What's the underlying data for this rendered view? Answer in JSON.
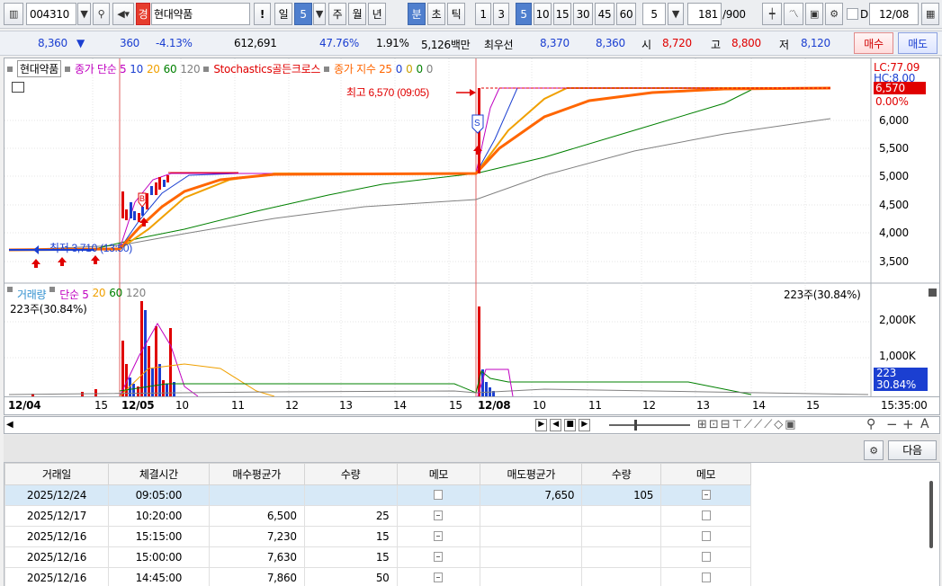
{
  "toolbar": {
    "code": "004310",
    "tag": "경",
    "name": "현대약품",
    "exclaim": "!",
    "periods": [
      "일",
      "5",
      "주",
      "월",
      "년",
      "분",
      "초",
      "틱"
    ],
    "selected_period": "분",
    "minutes": [
      "1",
      "3",
      "5",
      "10",
      "15",
      "30",
      "45",
      "60"
    ],
    "selected_minute": "5",
    "interval_value": "5",
    "count": "181",
    "count_total": "/900",
    "d_label": "D",
    "date": "12/08"
  },
  "quote": {
    "price": "8,360",
    "change_arrow": "▼",
    "change": "360",
    "change_pct": "-4.13%",
    "volume": "612,691",
    "vol_ratio": "47.76%",
    "turnover": "1.91%",
    "amount": "5,126백만",
    "best_label": "최우선",
    "best_ask": "8,370",
    "best_bid": "8,360",
    "open_label": "시",
    "open": "8,720",
    "high_label": "고",
    "high": "8,800",
    "low_label": "저",
    "low": "8,120",
    "buy_button": "매수",
    "sell_button": "매도"
  },
  "price_panel": {
    "legend": [
      {
        "text": "현대약품",
        "color": "#000000",
        "boxed": true
      },
      {
        "text": "종가 단순 5",
        "color": "#c000c0"
      },
      {
        "text": "10",
        "color": "#1b3fd1"
      },
      {
        "text": "20",
        "color": "#f0a000"
      },
      {
        "text": "60",
        "color": "#008000"
      },
      {
        "text": "120",
        "color": "#808080"
      },
      {
        "text": "Stochastics골든크로스",
        "color": "#e00000"
      },
      {
        "text": "종가 지수 25",
        "color": "#ff6600"
      },
      {
        "text": "0",
        "color": "#1b3fd1"
      },
      {
        "text": "0",
        "color": "#c8a000"
      },
      {
        "text": "0",
        "color": "#008000"
      },
      {
        "text": "0",
        "color": "#808080"
      }
    ],
    "high_annotation": "최고 6,570 (09:05)",
    "low_annotation": "최저 3,710 (13:50)",
    "lc_label": "LC:77.09",
    "hc_label": "HC:8.00",
    "current_price": "6,570",
    "current_pct": "0.00%",
    "y_ticks": [
      "6,000",
      "5,500",
      "5,000",
      "4,500",
      "4,000",
      "3,500"
    ],
    "marker_s": "S",
    "marker_b": "B"
  },
  "volume_panel": {
    "legend": [
      {
        "text": "거래량",
        "color": "#2f8fcf"
      },
      {
        "text": "단순 5",
        "color": "#c000c0"
      },
      {
        "text": "20",
        "color": "#f0a000"
      },
      {
        "text": "60",
        "color": "#008000"
      },
      {
        "text": "120",
        "color": "#808080"
      }
    ],
    "left_value": "223주(30.84%)",
    "right_value": "223주(30.84%)",
    "y_ticks": [
      "2,000K",
      "1,000K"
    ],
    "badge_value": "223",
    "badge_pct": "30.84%"
  },
  "x_axis": {
    "labels": [
      "12/04",
      "15",
      "12/05",
      "10",
      "11",
      "12",
      "13",
      "14",
      "15",
      "12/08",
      "10",
      "11",
      "12",
      "13",
      "14",
      "15"
    ],
    "bold": [
      "12/04",
      "12/05",
      "12/08"
    ],
    "time": "15:35:00"
  },
  "bottom": {
    "next_button": "다음"
  },
  "trades": {
    "headers": [
      "거래일",
      "체결시간",
      "매수평균가",
      "수량",
      "메모",
      "매도평균가",
      "수량",
      "메모"
    ],
    "rows": [
      [
        "2025/12/24",
        "09:05:00",
        "",
        "",
        "memo",
        "7,650",
        "105",
        "memo-on"
      ],
      [
        "2025/12/17",
        "10:20:00",
        "6,500",
        "25",
        "memo-on",
        "",
        "",
        "memo"
      ],
      [
        "2025/12/16",
        "15:15:00",
        "7,230",
        "15",
        "memo-on",
        "",
        "",
        "memo"
      ],
      [
        "2025/12/16",
        "15:00:00",
        "7,630",
        "15",
        "memo-on",
        "",
        "",
        "memo"
      ],
      [
        "2025/12/16",
        "14:45:00",
        "7,860",
        "50",
        "memo-on",
        "",
        "",
        "memo"
      ]
    ]
  }
}
